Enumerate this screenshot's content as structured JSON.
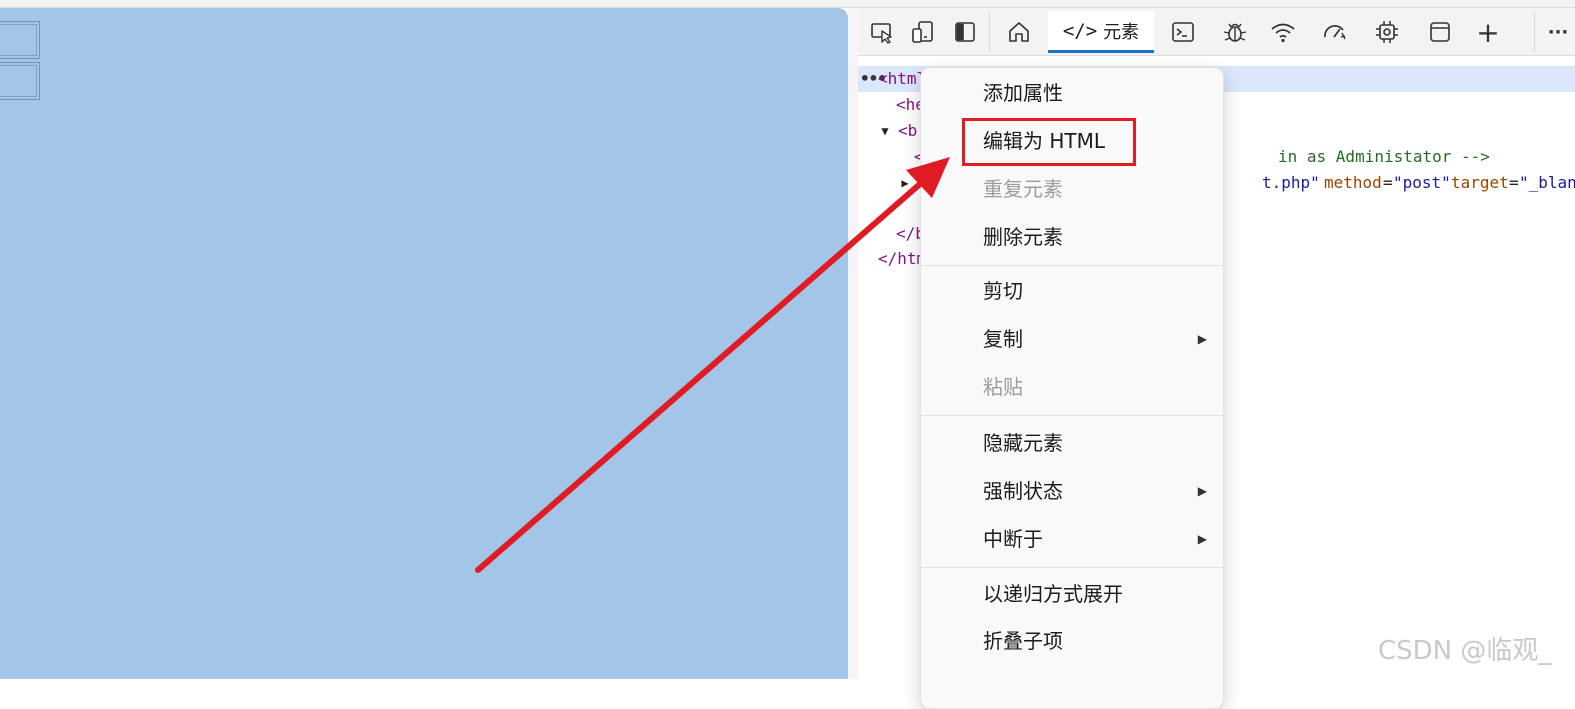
{
  "devtools": {
    "toolbar": {
      "elements_tab_label": "元素",
      "elements_tab_glyph": "</>",
      "add_tab_glyph": "+",
      "more_glyph": "···"
    },
    "code": {
      "line1": {
        "dots": "•••",
        "tag": "<html"
      },
      "line2": {
        "tag": "<he"
      },
      "line3": {
        "tag": "<b"
      },
      "line4": {
        "comment": "in as Administator -->"
      },
      "line5": {
        "val1": "t.php\"",
        "attr": "method",
        "val2": "\"post\"",
        "attr2": "target",
        "val3": "\"_blank"
      },
      "line6": {
        "tag": "</b"
      },
      "line7": {
        "tag": "</htm"
      }
    }
  },
  "context_menu": {
    "items": [
      {
        "label": "添加属性",
        "enabled": true
      },
      {
        "label": "编辑为 HTML",
        "enabled": true
      },
      {
        "label": "重复元素",
        "enabled": false
      },
      {
        "label": "删除元素",
        "enabled": true
      },
      {
        "label": "剪切",
        "enabled": true
      },
      {
        "label": "复制",
        "enabled": true,
        "submenu": true
      },
      {
        "label": "粘贴",
        "enabled": false
      },
      {
        "label": "隐藏元素",
        "enabled": true
      },
      {
        "label": "强制状态",
        "enabled": true,
        "submenu": true
      },
      {
        "label": "中断于",
        "enabled": true,
        "submenu": true
      },
      {
        "label": "以递归方式展开",
        "enabled": true
      },
      {
        "label": "折叠子项",
        "enabled": true
      }
    ],
    "submenu_arrow": "▶"
  },
  "annotation": {
    "color": "#e01b24"
  },
  "watermark": "CSDN @临观_",
  "colors": {
    "viewport": "#a3c5e8",
    "accent": "#1a73c7",
    "selected_line": "#dbe7fb"
  }
}
